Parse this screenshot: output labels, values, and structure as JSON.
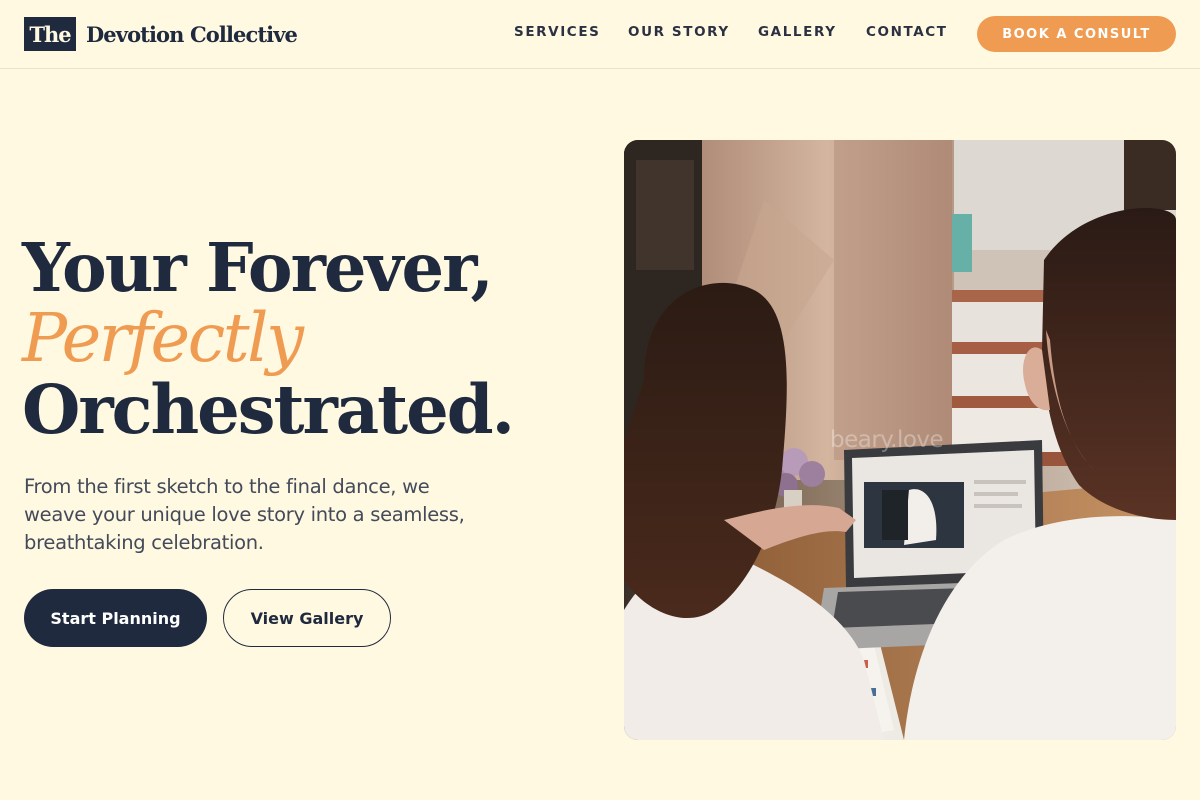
{
  "brand": {
    "mark": "The",
    "name": "Devotion Collective"
  },
  "nav": {
    "items": [
      {
        "label": "SERVICES"
      },
      {
        "label": "OUR STORY"
      },
      {
        "label": "GALLERY"
      },
      {
        "label": "CONTACT"
      }
    ],
    "cta_label": "BOOK A CONSULT"
  },
  "hero": {
    "title_line1": "Your Forever,",
    "title_accent": "Perfectly",
    "title_line3": "Orchestrated.",
    "subtitle": "From the first sketch to the final dance, we weave your unique love story into a seamless, breathtaking celebration.",
    "primary_cta": "Start Planning",
    "secondary_cta": "View Gallery",
    "image_watermark": "beary.love"
  },
  "colors": {
    "background": "#fff9e1",
    "navy": "#1f2a3f",
    "accent": "#ef9c52"
  }
}
